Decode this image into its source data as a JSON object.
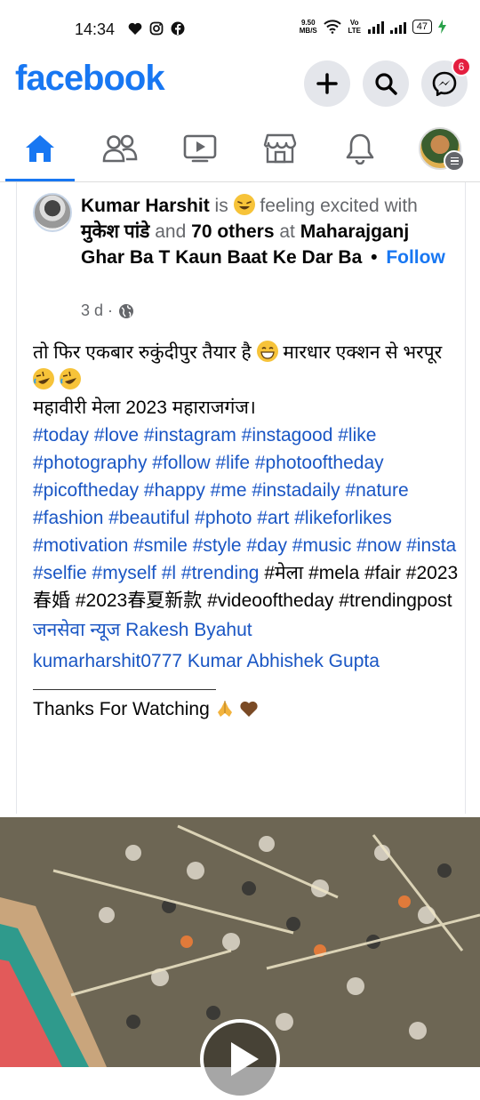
{
  "status_bar": {
    "time": "14:34",
    "network_speed_value": "9.50",
    "network_speed_unit": "MB/S",
    "volte_label": "Vo LTE",
    "battery": "47",
    "icons": [
      "heart-icon",
      "instagram-icon",
      "facebook-icon",
      "wifi-icon",
      "signal-icon",
      "battery-icon",
      "charging-icon"
    ]
  },
  "header": {
    "logo": "facebook",
    "buttons": [
      "create-icon",
      "search-icon",
      "messenger-icon"
    ],
    "messenger_badge": "6"
  },
  "nav": {
    "tabs": [
      "home-icon",
      "friends-icon",
      "watch-icon",
      "marketplace-icon",
      "notifications-icon",
      "profile-menu"
    ],
    "active": "home-icon"
  },
  "post": {
    "author": "Kumar Harshit",
    "is_text": "is",
    "feeling_text": "feeling excited",
    "with_text": "with",
    "tagged": "मुकेश पांडे",
    "and_text": "and",
    "others": "70 others",
    "at_text": "at",
    "location": "Maharajganj Ghar Ba T Kaun Baat Ke Dar Ba",
    "dot": "•",
    "follow": "Follow",
    "time": "3 d ·",
    "line1_a": "तो फिर एकबार रुकुंदीपुर तैयार है",
    "line1_b": "मारधार एक्शन से भरपूर",
    "line2": "महावीरी मेला 2023 महाराजगंज।",
    "hashtags": "#today #love #instagram #instagood #like #photography #follow #life #photooftheday #picoftheday #happy #me #instadaily #nature #fashion #beautiful #photo #art #likeforlikes #motivation #smile #style #day #music #now #insta #selfie #myself #l #trending",
    "plain_tags": "#मेला #mela  #fair  #2023春婚 #2023春夏新款 #videooftheday #trendingpost",
    "mention1": "जनसेवा न्यूज Rakesh Byahut",
    "mention2": "kumarharshit0777 Kumar Abhishek Gupta",
    "thanks": "Thanks For Watching"
  },
  "colors": {
    "brand": "#1877f2",
    "link": "#1a56c4",
    "badge": "#e41e3f",
    "secondary_text": "#65676b"
  }
}
